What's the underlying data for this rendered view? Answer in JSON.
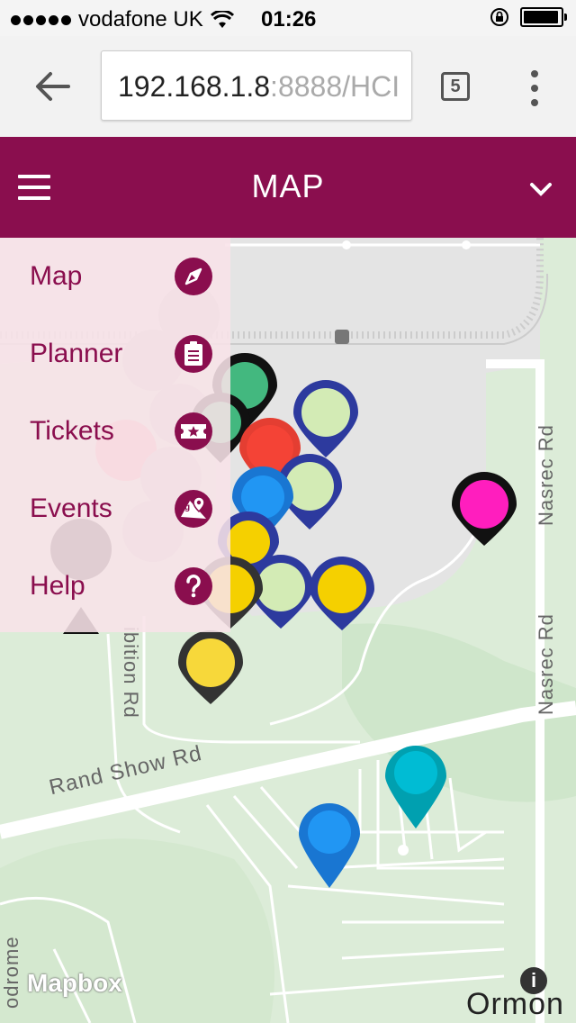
{
  "status_bar": {
    "carrier": "vodafone UK",
    "time": "01:26"
  },
  "browser": {
    "url_host": "192.168.1.8",
    "url_rest": ":8888/HCI",
    "tab_count": "5"
  },
  "header": {
    "title": "MAP"
  },
  "menu": {
    "items": [
      {
        "label": "Map",
        "icon": "compass-icon"
      },
      {
        "label": "Planner",
        "icon": "clipboard-icon"
      },
      {
        "label": "Tickets",
        "icon": "ticket-icon"
      },
      {
        "label": "Events",
        "icon": "map-pin-icon"
      },
      {
        "label": "Help",
        "icon": "help-icon"
      }
    ]
  },
  "map": {
    "road_labels": [
      "Rand Show Rd",
      "Nasrec Rd",
      "Nasrec Rd",
      "ibition Rd",
      "odrome"
    ],
    "attribution": "Mapbox",
    "info": "i",
    "place_label": "Ormon"
  },
  "colors": {
    "brand": "#8a0e4e",
    "menu_bg": "#f8e2e8",
    "map_bg": "#dcecd8"
  }
}
